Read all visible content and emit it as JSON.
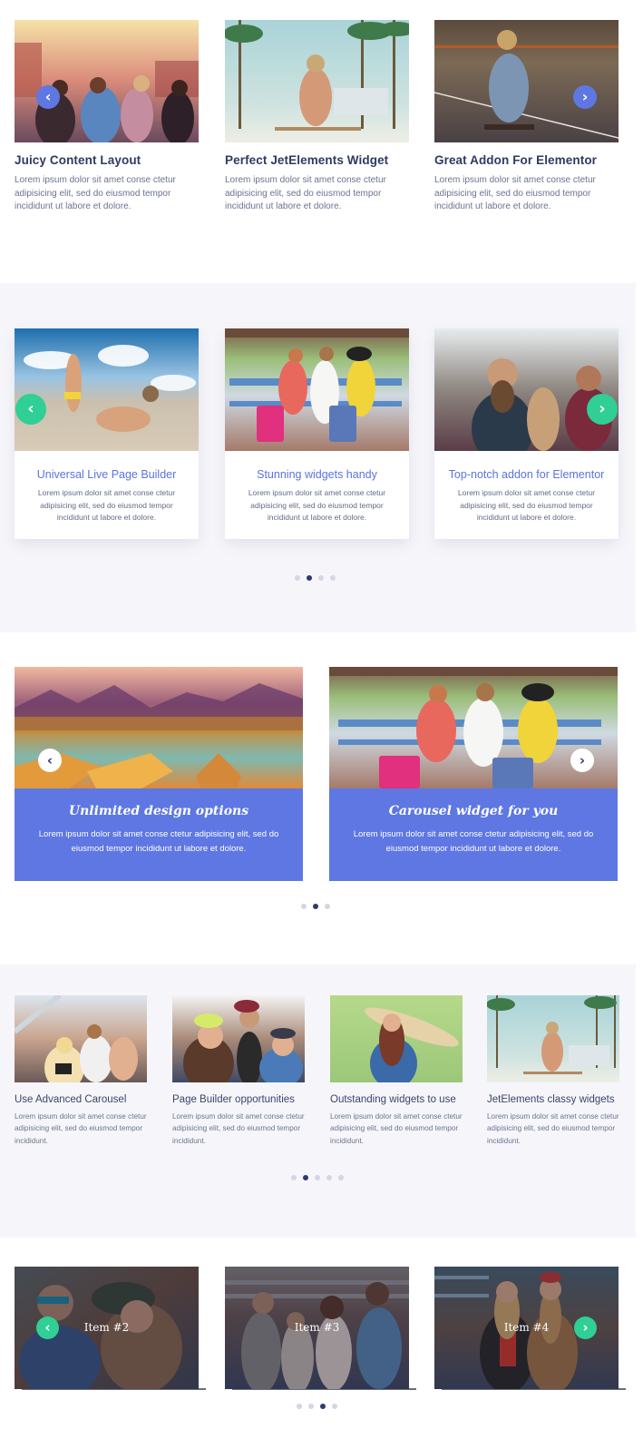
{
  "colors": {
    "section_bg": "#f6f6fa",
    "accent_blue": "#5e77e3",
    "accent_green": "#2fcf96",
    "dot_active": "#2b3a72",
    "dot_inactive": "#d3d6e4",
    "heading_dark": "#2f3a63"
  },
  "section1": {
    "prev_icon": "chevron-left-icon",
    "next_icon": "chevron-right-icon",
    "prev_glyph": "‹",
    "next_glyph": "›",
    "cards": [
      {
        "title": "Juicy Content Layout",
        "text": "Lorem ipsum dolor sit amet conse ctetur adipisicing elit, sed do eiusmod tempor incididunt ut labore et dolore.",
        "image": "friends-sitting-on-pier"
      },
      {
        "title": "Perfect JetElements Widget",
        "text": "Lorem ipsum dolor sit amet conse ctetur adipisicing elit, sed do eiusmod tempor incididunt ut labore et dolore.",
        "image": "woman-on-skateboard-palms"
      },
      {
        "title": "Great Addon For Elementor",
        "text": "Lorem ipsum dolor sit amet conse ctetur adipisicing elit, sed do eiusmod tempor incididunt ut labore et dolore.",
        "image": "man-sitting-on-longboard"
      }
    ]
  },
  "section2": {
    "prev_glyph": "‹",
    "next_glyph": "›",
    "cards": [
      {
        "title": "Universal Live Page Builder",
        "text": "Lorem ipsum dolor sit amet conse ctetur adipisicing elit, sed do eiusmod tempor incididunt ut labore et dolore.",
        "image": "beach-photoshoot"
      },
      {
        "title": "Stunning widgets handy",
        "text": "Lorem ipsum dolor sit amet conse ctetur adipisicing elit, sed do eiusmod tempor incididunt ut labore et dolore.",
        "image": "three-women-with-suitcases"
      },
      {
        "title": "Top-notch addon for Elementor",
        "text": "Lorem ipsum dolor sit amet conse ctetur adipisicing elit, sed do eiusmod tempor incididunt ut labore et dolore.",
        "image": "bearded-man-with-friends"
      }
    ],
    "dots": {
      "count": 4,
      "active": 1
    }
  },
  "section3": {
    "prev_glyph": "‹",
    "next_glyph": "›",
    "cards": [
      {
        "title": "Unlimited design options",
        "text": "Lorem ipsum dolor sit amet conse ctetur adipisicing elit, sed do eiusmod tempor incididunt ut labore et dolore.",
        "image": "mountain-lake-boats"
      },
      {
        "title": "Carousel widget for you",
        "text": "Lorem ipsum dolor sit amet conse ctetur adipisicing elit, sed do eiusmod tempor incididunt ut labore et dolore.",
        "image": "three-women-with-suitcases"
      }
    ],
    "dots": {
      "count": 3,
      "active": 1
    }
  },
  "section4": {
    "cards": [
      {
        "title": "Use Advanced Carousel",
        "text": "Lorem ipsum dolor sit amet conse ctetur adipisicing elit, sed do eiusmod tempor incididunt.",
        "image": "friends-on-yacht"
      },
      {
        "title": "Page Builder opportunities",
        "text": "Lorem ipsum dolor sit amet conse ctetur adipisicing elit, sed do eiusmod tempor incididunt.",
        "image": "three-friends-laughing"
      },
      {
        "title": "Outstanding widgets to use",
        "text": "Lorem ipsum dolor sit amet conse ctetur adipisicing elit, sed do eiusmod tempor incididunt.",
        "image": "girl-with-skateboard-green-wall"
      },
      {
        "title": "JetElements classy widgets",
        "text": "Lorem ipsum dolor sit amet conse ctetur adipisicing elit, sed do eiusmod tempor incididunt.",
        "image": "woman-on-skateboard-palms"
      }
    ],
    "dots": {
      "count": 5,
      "active": 1
    }
  },
  "section5": {
    "prev_glyph": "‹",
    "next_glyph": "›",
    "cards": [
      {
        "label": "Item #2",
        "image": "two-women-sunglasses"
      },
      {
        "label": "Item #3",
        "image": "friends-with-phones"
      },
      {
        "label": "Item #4",
        "image": "two-girls-peace-sign"
      }
    ],
    "dots": {
      "count": 4,
      "active": 2
    }
  }
}
